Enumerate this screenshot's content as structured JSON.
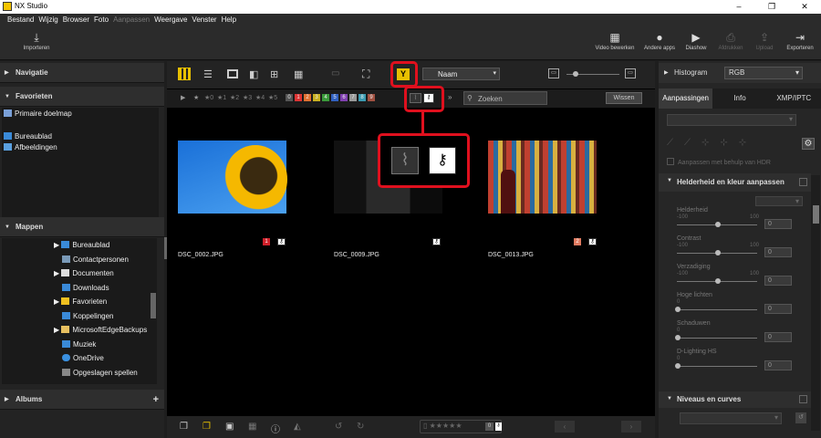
{
  "app": {
    "title": "NX Studio",
    "window_controls": [
      "–",
      "❐",
      "✕"
    ]
  },
  "menu": [
    "Bestand",
    "Wijzig",
    "Browser",
    "Foto",
    "Aanpassen",
    "Weergave",
    "Venster",
    "Help"
  ],
  "toolbar": {
    "import": "Importeren",
    "video": "Video bewerken",
    "other_apps": "Andere apps",
    "slideshow": "Diashow",
    "print": "Afdrukken",
    "upload": "Upload",
    "export": "Exporteren"
  },
  "left": {
    "navigation": "Navigatie",
    "favorites": "Favorieten",
    "fav_items": [
      "Primaire doelmap",
      "Bureaublad",
      "Afbeeldingen"
    ],
    "folders": "Mappen",
    "folder_items": [
      "Bureaublad",
      "Contactpersonen",
      "Documenten",
      "Downloads",
      "Favorieten",
      "Koppelingen",
      "MicrosoftEdgeBackups",
      "Muziek",
      "OneDrive",
      "Opgeslagen spellen"
    ],
    "albums": "Albums",
    "albums_add": "+"
  },
  "browser": {
    "sort": "Naam",
    "search_placeholder": "Zoeken",
    "clear": "Wissen",
    "rating_filters": [
      "★0",
      "★1",
      "★2",
      "★3",
      "★4",
      "★5"
    ],
    "label_filters": [
      "0",
      "1",
      "2",
      "3",
      "4",
      "5",
      "6",
      "7",
      "8",
      "9"
    ],
    "label_colors": [
      "#555",
      "#d33",
      "#e07030",
      "#c8b020",
      "#3a9a3a",
      "#3060c0",
      "#8040b0",
      "#999",
      "#3a9ab0",
      "#a05040"
    ],
    "thumbs": [
      {
        "name": "DSC_0002.JPG",
        "label": "1",
        "label_color": "#d0202a"
      },
      {
        "name": "DSC_0009.JPG",
        "label": "",
        "label_color": ""
      },
      {
        "name": "DSC_0013.JPG",
        "label": "2",
        "label_color": "#e07a60"
      }
    ],
    "bottom_label": "0"
  },
  "right": {
    "histogram": "Histogram",
    "histogram_mode": "RGB",
    "tabs": [
      "Aanpassingen",
      "Info",
      "XMP/IPTC"
    ],
    "hdr_option": "Aanpassen met behulp van HDR",
    "section1": "Helderheid en kleur aanpassen",
    "sliders": [
      {
        "label": "Helderheid",
        "min": "-100",
        "max": "100",
        "value": "0"
      },
      {
        "label": "Contrast",
        "min": "-100",
        "max": "100",
        "value": "0"
      },
      {
        "label": "Verzadiging",
        "min": "-100",
        "max": "100",
        "value": "0"
      },
      {
        "label": "Hoge lichten",
        "min": "0",
        "max": "",
        "value": "0"
      },
      {
        "label": "Schaduwen",
        "min": "0",
        "max": "",
        "value": "0"
      },
      {
        "label": "D-Lighting HS",
        "min": "0",
        "max": "",
        "value": "0"
      }
    ],
    "section2": "Niveaus en curves"
  }
}
